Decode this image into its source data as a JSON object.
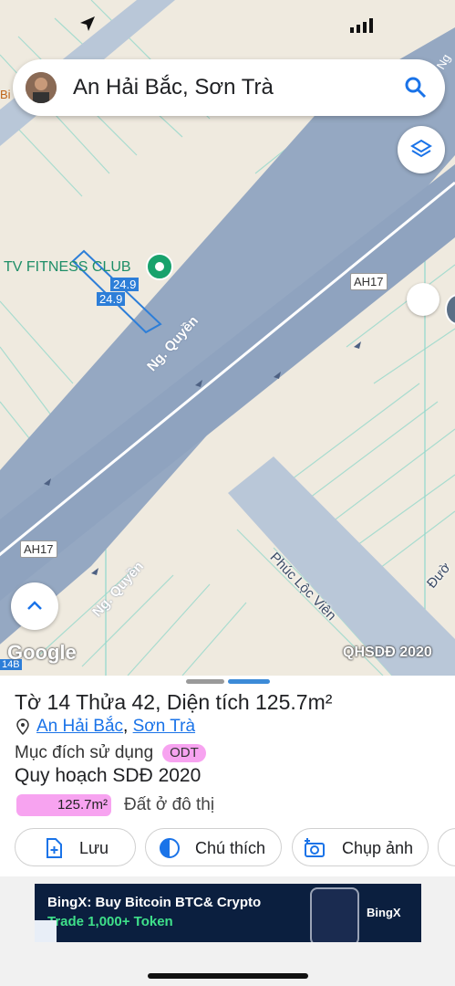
{
  "search": {
    "text": "An Hải Bắc, Sơn Trà"
  },
  "map": {
    "poi_name": "TV FITNESS CLUB",
    "dimension_top": "24.9",
    "dimension_bottom": "24.9",
    "road_name": "Ng. Quyền",
    "road_name_lower": "Ng. Quyền",
    "side_road": "Phúc Lộc Viên",
    "route_tag_right": "AH17",
    "route_tag_left": "AH17",
    "edge_label_left": "14B",
    "edge_label_right": "Đườ",
    "edge_label_top_left": "Bi",
    "edge_label_top_right": "Ng",
    "google": "Google",
    "layer_name": "QHSDĐ 2020"
  },
  "sheet": {
    "title": "Tờ 14 Thửa 42, Diện tích 125.7m²",
    "location_ward": "An Hải Bắc",
    "location_sep": ",",
    "location_district": "Sơn Trà",
    "purpose_label": "Mục đích sử dụng",
    "purpose_code": "ODT",
    "plan_label": "Quy hoạch SDĐ 2020",
    "area_value": "125.7m²",
    "area_desc": "Đất ở đô thị",
    "actions": {
      "save": "Lưu",
      "legend": "Chú thích",
      "screenshot": "Chụp ảnh"
    }
  },
  "ad": {
    "title": "BingX: Buy Bitcoin BTC& Crypto",
    "subtitle": "Trade 1,000+ Token",
    "brand": "BingX"
  }
}
